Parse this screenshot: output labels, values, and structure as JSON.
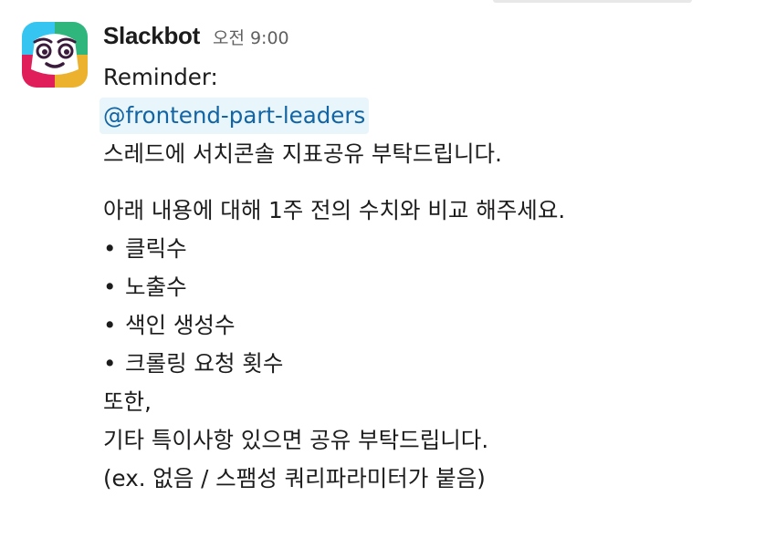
{
  "message": {
    "sender": "Slackbot",
    "timestamp": "오전 9:00",
    "avatar_icon": "slackbot-face-icon",
    "lines_top": [
      "Reminder:"
    ],
    "mention": "@frontend-part-leaders",
    "request_line": "스레드에 서치콘솔 지표공유 부탁드립니다.",
    "intro_line": "아래 내용에 대해 1주 전의 수치와 비교 해주세요.",
    "bullet_char": "•",
    "bullets": [
      "클릭수",
      "노출수",
      "색인 생성수",
      "크롤링 요청 횟수"
    ],
    "closing_lines": [
      "또한,",
      "기타 특이사항 있으면 공유 부탁드립니다.",
      "(ex. 없음 / 스팸성 쿼리파라미터가 붙음)"
    ]
  },
  "colors": {
    "mention_bg": "#e8f5fa",
    "mention_text": "#1264a3",
    "text": "#1d1c1d",
    "timestamp": "#616061"
  }
}
